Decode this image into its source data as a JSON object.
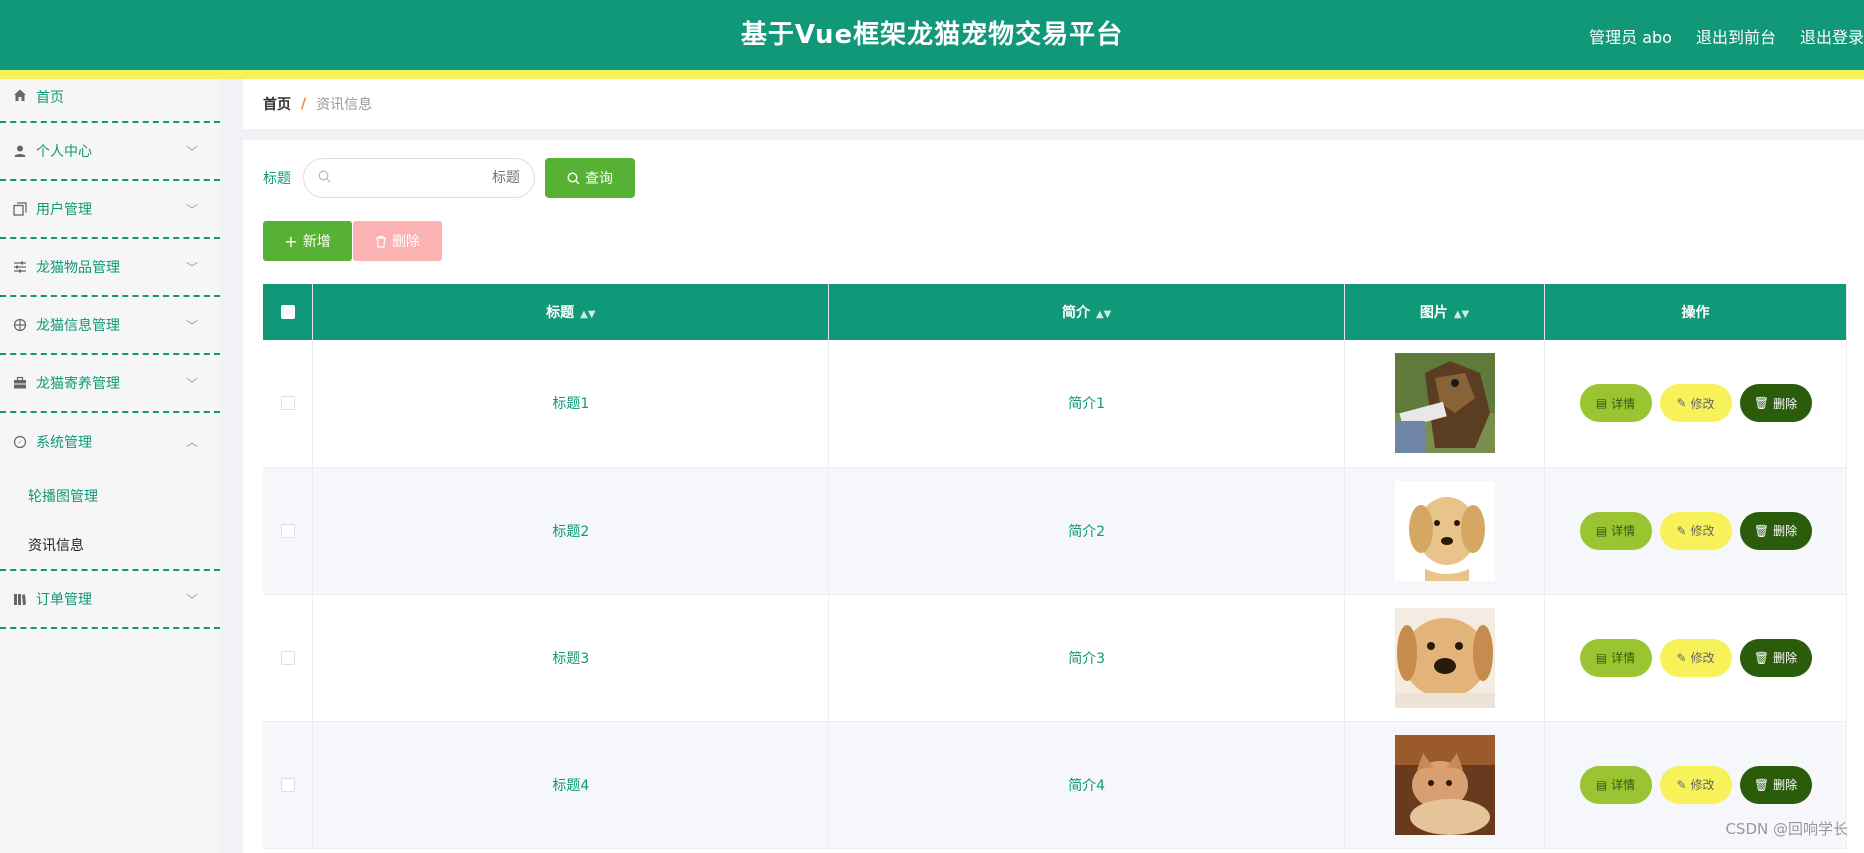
{
  "header": {
    "title": "基于Vue框架龙猫宠物交易平台",
    "user_label": "管理员 abo",
    "front_label": "退出到前台",
    "logout_label": "退出登录"
  },
  "sidebar": {
    "items": [
      {
        "label": "首页",
        "icon": "home-icon"
      },
      {
        "label": "个人中心",
        "icon": "user-icon"
      },
      {
        "label": "用户管理",
        "icon": "copy-icon"
      },
      {
        "label": "龙猫物品管理",
        "icon": "sliders-icon"
      },
      {
        "label": "龙猫信息管理",
        "icon": "crosshair-icon"
      },
      {
        "label": "龙猫寄养管理",
        "icon": "briefcase-icon"
      },
      {
        "label": "系统管理",
        "icon": "compass-icon"
      },
      {
        "label": "订单管理",
        "icon": "books-icon"
      }
    ],
    "sub_items": [
      "轮播图管理",
      "资讯信息"
    ]
  },
  "breadcrumb": {
    "home": "首页",
    "sep": "/",
    "current": "资讯信息"
  },
  "search": {
    "label": "标题",
    "placeholder": "标题",
    "button": "查询"
  },
  "toolbar": {
    "add": "新增",
    "delete": "删除"
  },
  "table": {
    "headers": [
      "标题",
      "简介",
      "图片",
      "操作"
    ],
    "rows": [
      {
        "title": "标题1",
        "intro": "简介1"
      },
      {
        "title": "标题2",
        "intro": "简介2"
      },
      {
        "title": "标题3",
        "intro": "简介3"
      },
      {
        "title": "标题4",
        "intro": "简介4"
      }
    ],
    "actions": {
      "detail": "详情",
      "edit": "修改",
      "delete": "删除"
    }
  },
  "watermark": "CSDN @回响学长",
  "colors": {
    "primary": "#109878",
    "accent": "#f7f25a",
    "green": "#57b135",
    "dark": "#2b5c0c"
  }
}
